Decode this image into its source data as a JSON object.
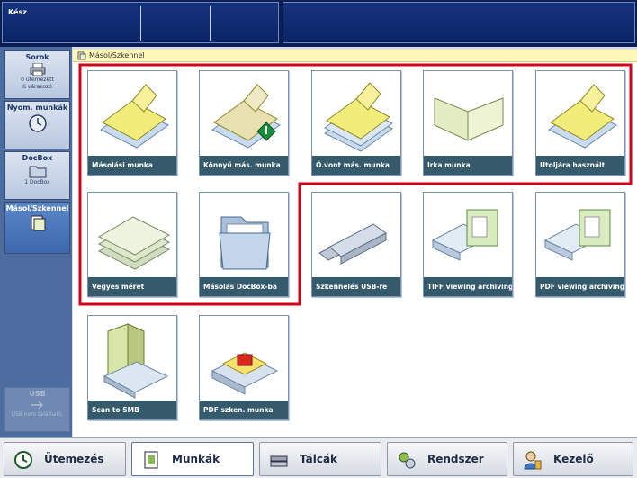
{
  "status": {
    "text": "Kész"
  },
  "breadcrumb": {
    "label": "Másol/Szkennel"
  },
  "sidebar": {
    "items": [
      {
        "title": "Sorok",
        "sub1": "0 ütemezett",
        "sub2": "6 várakozó",
        "icon": "printer-icon"
      },
      {
        "title": "Nyom. munkák",
        "icon": "clock-icon"
      },
      {
        "title": "DocBox",
        "sub1": "1 DocBox",
        "icon": "folder-icon"
      },
      {
        "title": "Másol/Szkennel",
        "icon": "copy-scan-icon"
      },
      {
        "title": "USB",
        "sub1": "USB nem található.",
        "icon": "usb-icon"
      }
    ]
  },
  "tiles": [
    {
      "label": "Másolási munka",
      "icon": "copy-job-icon"
    },
    {
      "label": "Könnyű más. munka",
      "icon": "easy-copy-icon"
    },
    {
      "label": "Ö.vont más. munka",
      "icon": "combined-copy-icon"
    },
    {
      "label": "Irka munka",
      "icon": "booklet-icon"
    },
    {
      "label": "Utoljára használt",
      "icon": "last-used-icon"
    },
    {
      "label": "Vegyes méret",
      "icon": "mixed-size-icon"
    },
    {
      "label": "Másolás DocBox-ba",
      "icon": "docbox-folder-icon"
    },
    {
      "label": "Szkennelés USB-re",
      "icon": "usb-drive-icon"
    },
    {
      "label": "TIFF viewing archiving",
      "icon": "scanner-tiff-icon"
    },
    {
      "label": "PDF viewing archiving",
      "icon": "scanner-pdf-icon"
    },
    {
      "label": "Scan to SMB",
      "icon": "server-scan-icon"
    },
    {
      "label": "PDF szken. munka",
      "icon": "pdf-scan-icon"
    }
  ],
  "nav": {
    "items": [
      {
        "label": "Ütemezés",
        "icon": "schedule-icon"
      },
      {
        "label": "Munkák",
        "icon": "jobs-icon"
      },
      {
        "label": "Tálcák",
        "icon": "trays-icon"
      },
      {
        "label": "Rendszer",
        "icon": "system-icon"
      },
      {
        "label": "Kezelő",
        "icon": "operator-icon"
      }
    ],
    "active": "Munkák"
  },
  "colors": {
    "highlight": "#d3001b",
    "tile_label_bg": "#345a6b",
    "breadcrumb_bg": "#fff7b8",
    "sidebar_bg": "#4d6da0"
  }
}
